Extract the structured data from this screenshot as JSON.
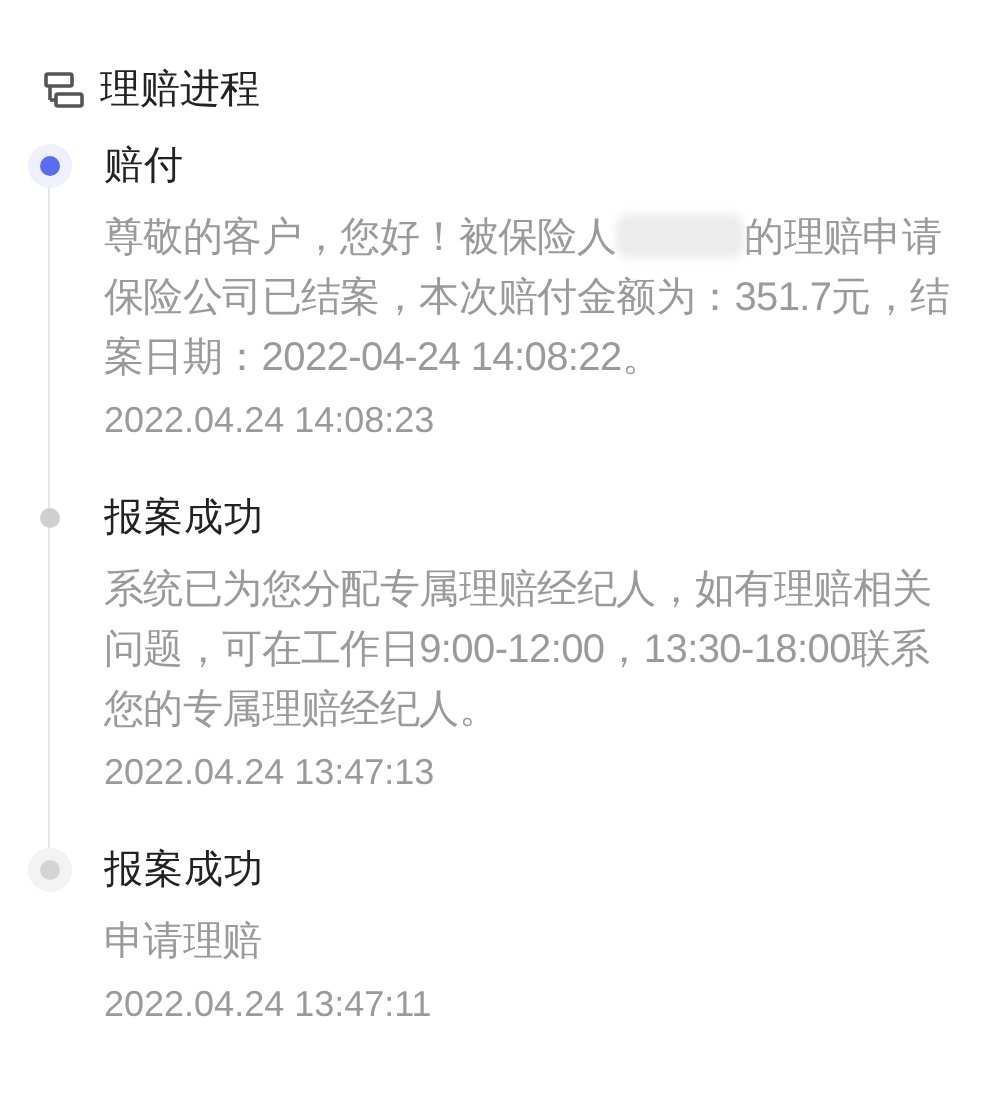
{
  "header": {
    "title": "理赔进程"
  },
  "timeline": [
    {
      "kind": "current",
      "title": "赔付",
      "description_parts": [
        "尊敬的客户，您好！被保险人",
        "的理赔申请保险公司已结案，本次赔付金额为：351.7元，结案日期：2022-04-24 14:08:22。"
      ],
      "time": "2022.04.24 14:08:23"
    },
    {
      "kind": "past",
      "title": "报案成功",
      "description_parts": [
        "系统已为您分配专属理赔经纪人，如有理赔相关问题，可在工作日9:00-12:00，13:30-18:00联系您的专属理赔经纪人。"
      ],
      "time": "2022.04.24 13:47:13"
    },
    {
      "kind": "origin",
      "title": "报案成功",
      "description_parts": [
        "申请理赔"
      ],
      "time": "2022.04.24 13:47:11"
    }
  ]
}
